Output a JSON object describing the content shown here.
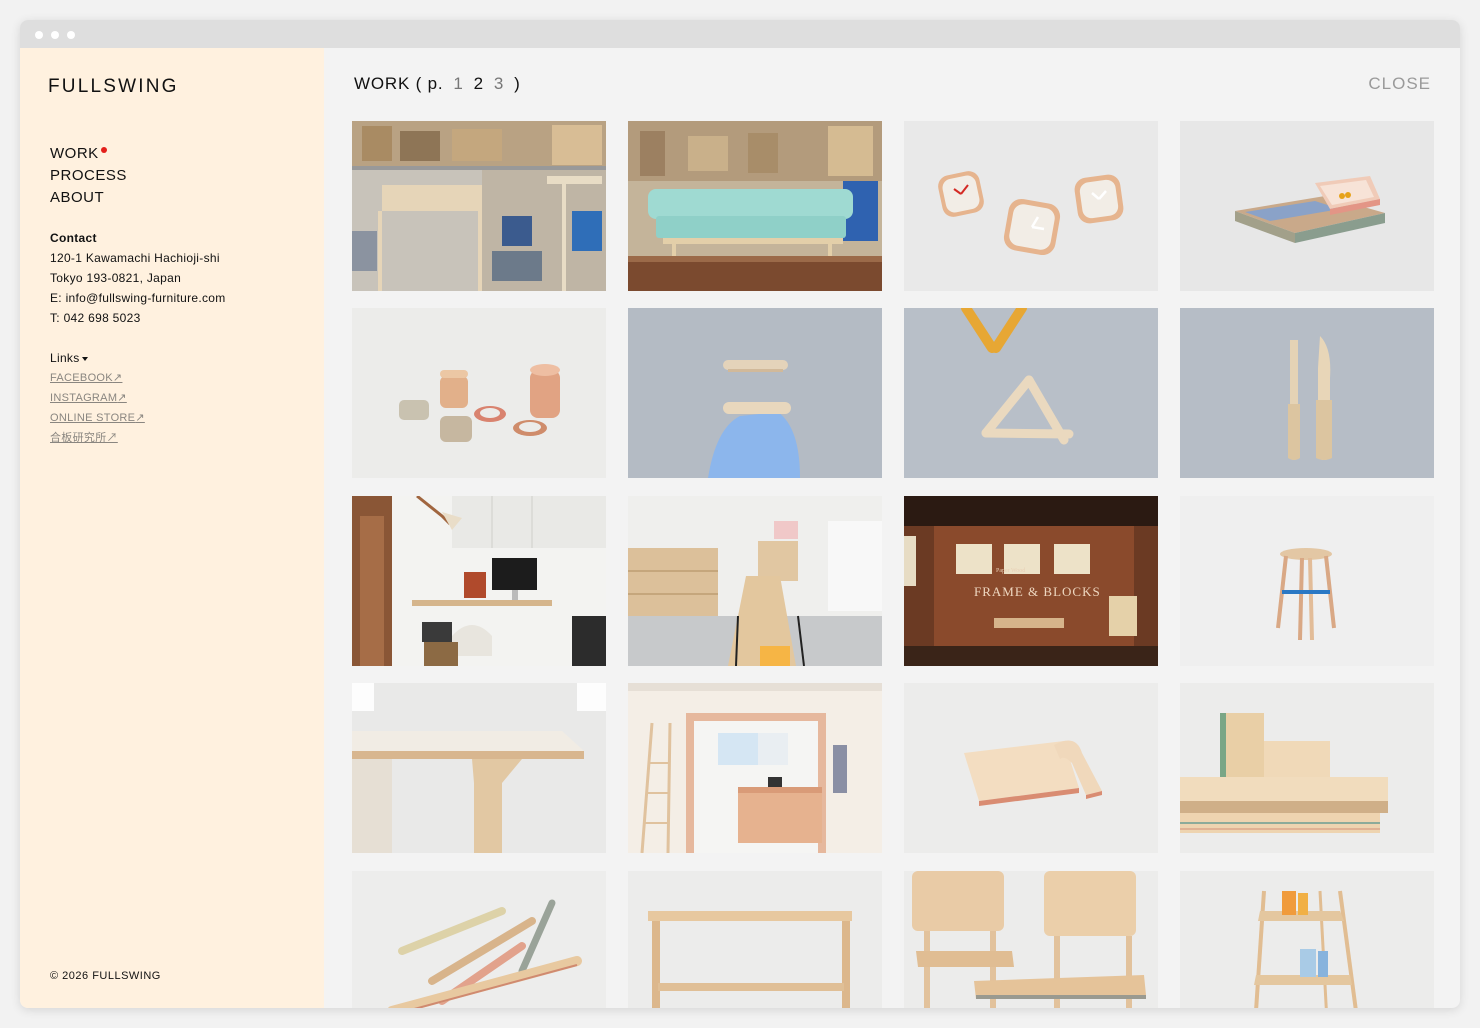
{
  "brand": "FULLSWING",
  "nav": {
    "work": "WORK",
    "process": "PROCESS",
    "about": "ABOUT"
  },
  "contact": {
    "heading": "Contact",
    "address1": "120-1 Kawamachi Hachioji-shi",
    "address2": "Tokyo 193-0821, Japan",
    "email": "E: info@fullswing-furniture.com",
    "phone": "T: 042 698 5023"
  },
  "links": {
    "heading": "Links",
    "items": [
      "FACEBOOK",
      "INSTAGRAM",
      "ONLINE STORE",
      "合板研究所"
    ],
    "arrow": "↗"
  },
  "copyright": "© 2026  FULLSWING",
  "page": {
    "title": "WORK ( p.",
    "pages": [
      "1",
      "2",
      "3"
    ],
    "current": "2",
    "close_paren": ")",
    "close": "CLOSE"
  },
  "gallery": {
    "sign_line1": "Paper Wood",
    "sign_line2": "FRAME & BLOCKS",
    "items": [
      "workshop-shelves",
      "mint-sofa",
      "clocks",
      "trays",
      "stacked-rings",
      "paper-holder",
      "triangle-sticks",
      "knife-pair",
      "home-office",
      "library-room",
      "frame-blocks-shop",
      "stool-blue",
      "table-corner",
      "kitchen-room",
      "puzzle-board",
      "stacked-blocks",
      "colored-pencils",
      "wooden-bench",
      "plywood-chairs",
      "magazine-rack"
    ]
  },
  "colors": {
    "accent": "#e3201b",
    "sidebar": "#fff1df",
    "wood": "#e8cfa8"
  }
}
